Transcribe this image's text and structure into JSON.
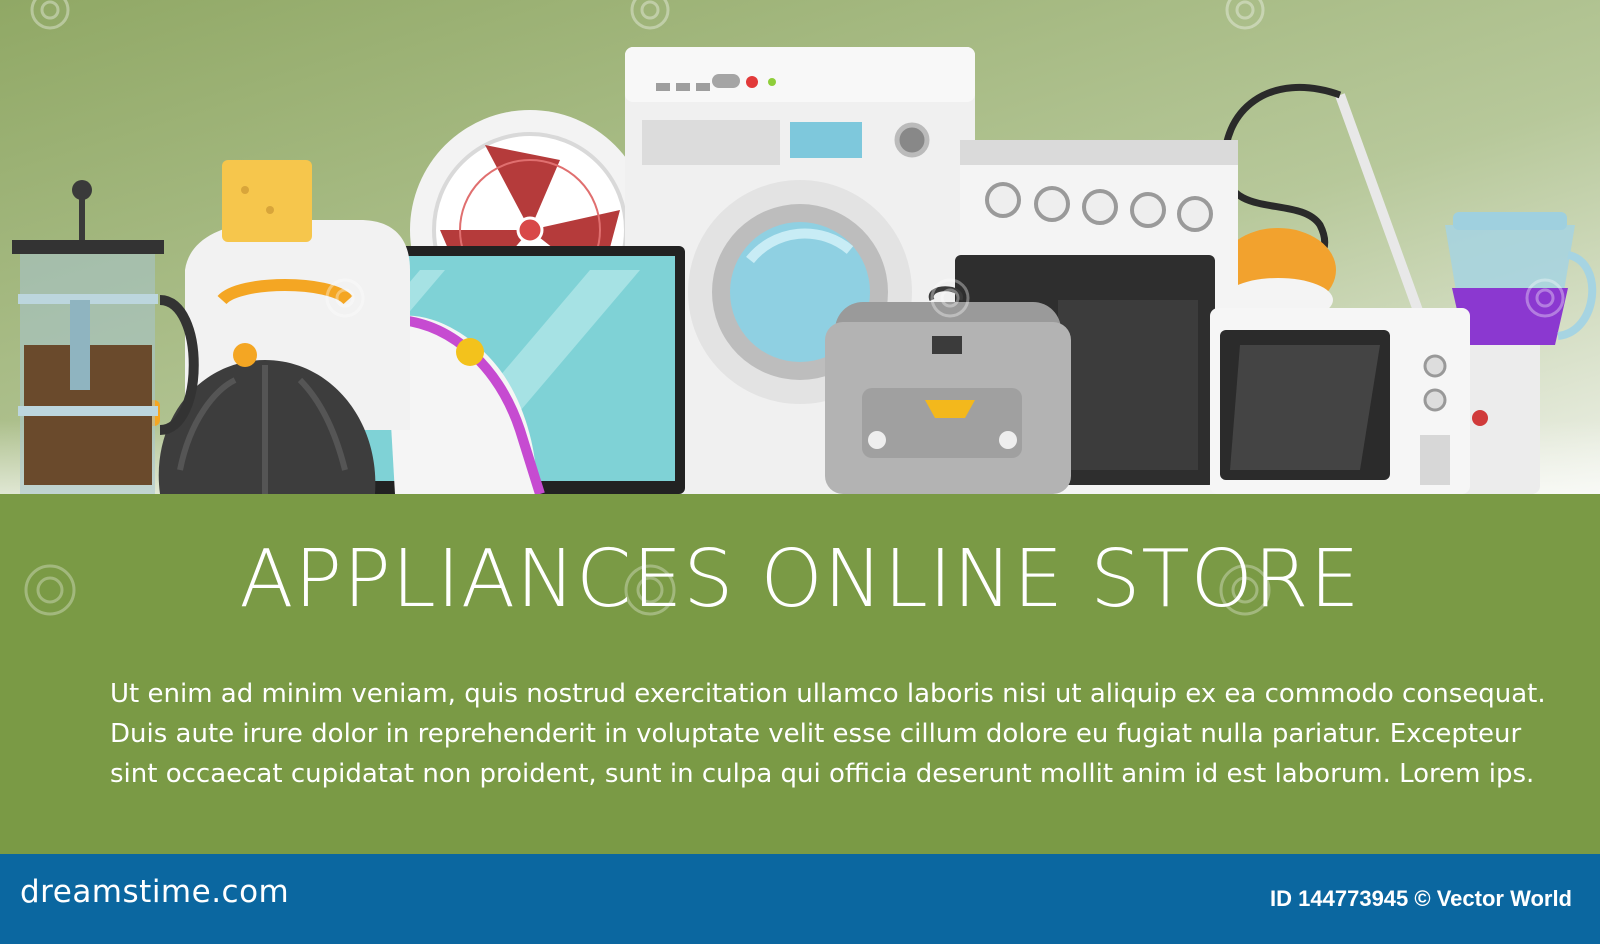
{
  "colors": {
    "sky_top": "#93ab6a",
    "sky_bottom": "#e2e8d9",
    "panel": "#7a9a45",
    "footer": "#0b67a0",
    "text": "#ffffff"
  },
  "illustration": {
    "items": [
      "french-press-icon",
      "toaster-icon",
      "fan-icon",
      "washing-machine-icon",
      "oven-icon",
      "vacuum-cleaner-icon",
      "blender-icon",
      "kettle-icon",
      "tv-icon",
      "iron-icon",
      "multicooker-icon",
      "microwave-icon"
    ]
  },
  "banner": {
    "title": "APPLIANCES ONLINE STORE",
    "body_lines": [
      "Ut enim ad minim veniam, quis nostrud exercitation ullamco laboris nisi ut aliquip ex ea commodo consequat.",
      "Duis aute irure dolor in reprehenderit in voluptate velit esse cillum dolore eu fugiat nulla pariatur. Excepteur",
      "sint occaecat cupidatat non proident, sunt in culpa qui officia deserunt mollit anim id est laborum. Lorem ips."
    ]
  },
  "footer": {
    "brand": "dreamstime.com",
    "id_text": "ID 144773945 © Vector World"
  }
}
